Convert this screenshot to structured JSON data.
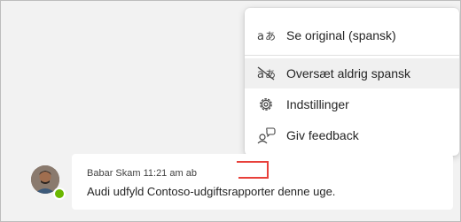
{
  "menu": {
    "items": [
      {
        "label": "Se original (spansk)",
        "icon": "translate-icon"
      },
      {
        "label": "Oversæt aldrig spansk",
        "icon": "no-translate-icon"
      },
      {
        "label": "Indstillinger",
        "icon": "gear-icon"
      },
      {
        "label": "Giv feedback",
        "icon": "feedback-icon"
      }
    ]
  },
  "message": {
    "sender": "Babar Skam",
    "time": "11:21 am ab",
    "text": "Audi udfyld Contoso-udgiftsrapporter denne uge."
  },
  "colors": {
    "presence": "#6bb700",
    "annotation": "#e8403a"
  }
}
